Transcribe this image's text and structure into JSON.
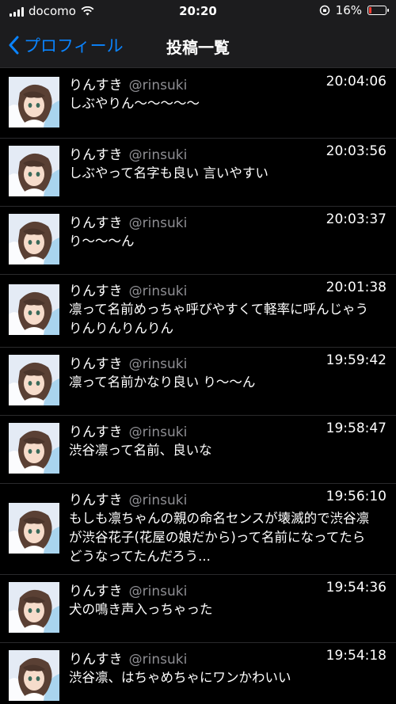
{
  "status_bar": {
    "carrier": "docomo",
    "time": "20:20",
    "battery_percent": "16%",
    "battery_level": 0.16
  },
  "nav": {
    "back_label": "プロフィール",
    "title": "投稿一覧"
  },
  "posts": [
    {
      "name": "りんすき",
      "handle": "@rinsuki",
      "time": "20:04:06",
      "text": "しぶやりん〜〜〜〜〜"
    },
    {
      "name": "りんすき",
      "handle": "@rinsuki",
      "time": "20:03:56",
      "text": "しぶやって名字も良い 言いやすい"
    },
    {
      "name": "りんすき",
      "handle": "@rinsuki",
      "time": "20:03:37",
      "text": "り〜〜〜ん"
    },
    {
      "name": "りんすき",
      "handle": "@rinsuki",
      "time": "20:01:38",
      "text": "凛って名前めっちゃ呼びやすくて軽率に呼んじゃう\nりんりんりんりん"
    },
    {
      "name": "りんすき",
      "handle": "@rinsuki",
      "time": "19:59:42",
      "text": "凛って名前かなり良い り〜〜ん"
    },
    {
      "name": "りんすき",
      "handle": "@rinsuki",
      "time": "19:58:47",
      "text": "渋谷凛って名前、良いな"
    },
    {
      "name": "りんすき",
      "handle": "@rinsuki",
      "time": "19:56:10",
      "text": "もしも凛ちゃんの親の命名センスが壊滅的で渋谷凛\nが渋谷花子(花屋の娘だから)って名前になってたら\nどうなってたんだろう..."
    },
    {
      "name": "りんすき",
      "handle": "@rinsuki",
      "time": "19:54:36",
      "text": "犬の鳴き声入っちゃった"
    },
    {
      "name": "りんすき",
      "handle": "@rinsuki",
      "time": "19:54:18",
      "text": "渋谷凛、はちゃめちゃにワンかわいい"
    }
  ]
}
